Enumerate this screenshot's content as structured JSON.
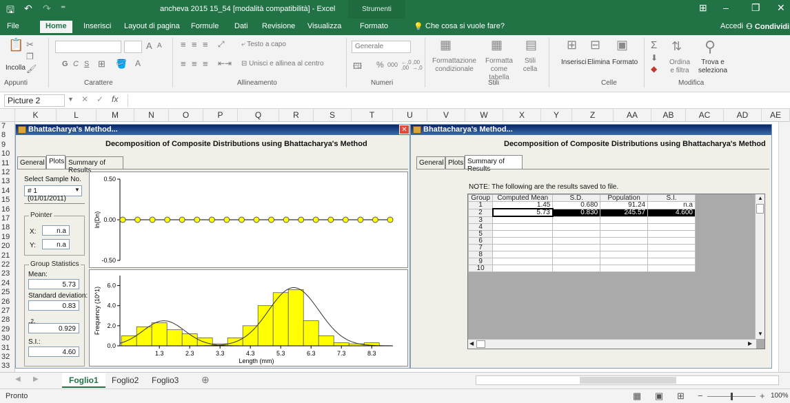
{
  "window": {
    "title": "ancheva 2015 15_54 [modalità compatibilità] - Excel",
    "context_tab": "Strumenti immagine",
    "minimize": "–",
    "restore": "❐",
    "close": "✕",
    "ribbon_display": "⊞"
  },
  "qat": {
    "save": "🖫",
    "undo": "↶",
    "redo": "↷",
    "customize": "⁼"
  },
  "ribbon_tabs": [
    "File",
    "Home",
    "Inserisci",
    "Layout di pagina",
    "Formule",
    "Dati",
    "Revisione",
    "Visualizza",
    "Formato"
  ],
  "tell_me": "Che cosa si vuole fare?",
  "account": {
    "signin": "Accedi",
    "share": "Condividi"
  },
  "ribbon": {
    "paste": "Incolla",
    "bold": "G",
    "italic": "C",
    "underline": "S",
    "font_grow": "A",
    "font_shrink": "A",
    "wrap_text": "Testo a capo",
    "merge_center": "Unisci e allinea al centro",
    "number_format": "Generale",
    "percent": "%",
    "thousands": "000",
    "inc_decimal": "←,0 ,00",
    "dec_decimal": ",00 →,0",
    "conditional_format": "Formattazione condizionale",
    "format_table": "Formatta come tabella",
    "cell_styles": "Stili cella",
    "insert": "Inserisci",
    "delete": "Elimina",
    "format": "Formato",
    "sort_filter": "Ordina e filtra",
    "find_select": "Trova e seleziona",
    "groups": [
      "Appunti",
      "Carattere",
      "Allineamento",
      "Numeri",
      "Stili",
      "Celle",
      "Modifica"
    ]
  },
  "formula_bar": {
    "name_box": "Picture 2",
    "fx": "fx",
    "cancel": "✕",
    "enter": "✓",
    "value": ""
  },
  "columns": [
    "K",
    "L",
    "M",
    "N",
    "O",
    "P",
    "Q",
    "R",
    "S",
    "T",
    "U",
    "V",
    "W",
    "X",
    "Y",
    "Z",
    "AA",
    "AB",
    "AC",
    "AD",
    "AE"
  ],
  "rows": [
    "7",
    "8",
    "9",
    "10",
    "11",
    "12",
    "13",
    "14",
    "15",
    "16",
    "17",
    "18",
    "19",
    "20",
    "21",
    "22",
    "23",
    "24",
    "25",
    "26",
    "27",
    "28",
    "29",
    "30",
    "31",
    "32",
    "33"
  ],
  "dialog_left": {
    "title": "Bhattacharya's Method...",
    "heading": "Decomposition of Composite Distributions using Bhattacharya's Method",
    "tabs": [
      "General",
      "Plots",
      "Summary of Results"
    ],
    "close": "✕",
    "select_sample_label": "Select Sample No.",
    "select_sample_value": "# 1 (01/01/2011)",
    "pointer_label": "Pointer",
    "x_label": "X:",
    "x_value": "n.a",
    "y_label": "Y:",
    "y_value": "n.a",
    "group_stats_label": "Group Statistics",
    "mean_label": "Mean:",
    "mean_value": "5.73",
    "sd_label": "Standard deviation:",
    "sd_value": "0.83",
    "r2_label": "r",
    "r2_sup": "2",
    "r2_colon": ":",
    "r2_value": "0.929",
    "si_label": "S.I.:",
    "si_value": "4.60"
  },
  "dialog_right": {
    "title": "Bhattacharya's Method...",
    "heading": "Decomposition of Composite Distributions using Bhattacharya's Method",
    "tabs": [
      "General",
      "Plots",
      "Summary of Results"
    ],
    "note": "NOTE: The following are the results saved to file.",
    "table": {
      "headers": [
        "Group",
        "Computed Mean",
        "S.D.",
        "Population",
        "S.I."
      ],
      "rows": [
        [
          "1",
          "1.45",
          "0.680",
          "91.24",
          "n.a"
        ],
        [
          "2",
          "5.73",
          "0.830",
          "245.57",
          "4.600"
        ],
        [
          "3",
          "",
          "",
          "",
          ""
        ],
        [
          "4",
          "",
          "",
          "",
          ""
        ],
        [
          "5",
          "",
          "",
          "",
          ""
        ],
        [
          "6",
          "",
          "",
          "",
          ""
        ],
        [
          "7",
          "",
          "",
          "",
          ""
        ],
        [
          "8",
          "",
          "",
          "",
          ""
        ],
        [
          "9",
          "",
          "",
          "",
          ""
        ],
        [
          "10",
          "",
          "",
          "",
          ""
        ]
      ]
    }
  },
  "chart_data": [
    {
      "type": "scatter",
      "title": "",
      "xlabel": "",
      "ylabel": "ln(Dn)",
      "ylim": [
        -0.5,
        0.5
      ],
      "yticks": [
        "0.50",
        "0.00",
        "-0.50"
      ],
      "points": [
        0,
        0,
        0,
        0,
        0,
        0,
        0,
        0,
        0,
        0,
        0,
        0,
        0,
        0,
        0,
        0,
        0,
        0,
        0
      ],
      "point_color": "#ffff00",
      "grid": false
    },
    {
      "type": "bar",
      "title": "",
      "xlabel": "Length (mm)",
      "ylabel": "Frequency (10^1)",
      "ylim": [
        0,
        7
      ],
      "yticks": [
        "0.0",
        "2.0",
        "4.0",
        "6.0"
      ],
      "xticks": [
        "1.3",
        "2.3",
        "3.3",
        "4.3",
        "5.3",
        "6.3",
        "7.3",
        "8.3"
      ],
      "x": [
        0.3,
        0.8,
        1.3,
        1.8,
        2.3,
        2.8,
        3.3,
        3.8,
        4.3,
        4.8,
        5.3,
        5.8,
        6.3,
        6.8,
        7.3,
        7.8,
        8.3
      ],
      "values": [
        1.0,
        1.9,
        2.3,
        1.6,
        1.2,
        0.8,
        0.2,
        0.8,
        2.0,
        4.0,
        5.3,
        5.6,
        2.5,
        1.0,
        0.3,
        0.2,
        0.3
      ],
      "bar_color": "#ffff00",
      "fit_curves": [
        {
          "mean": 1.45,
          "sd": 0.68,
          "peak": 2.5
        },
        {
          "mean": 5.73,
          "sd": 0.83,
          "peak": 5.8
        }
      ],
      "grid": false
    }
  ],
  "sheets": [
    "Foglio1",
    "Foglio2",
    "Foglio3"
  ],
  "add_sheet": "⊕",
  "status": {
    "ready": "Pronto",
    "zoom": "100%"
  }
}
